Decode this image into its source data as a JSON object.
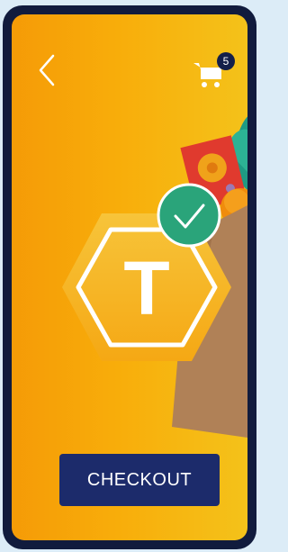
{
  "header": {
    "back_icon": "chevron-left-icon",
    "cart_icon": "shopping-cart-icon",
    "cart_count": "5"
  },
  "badge": {
    "letter": "T",
    "check_icon": "checkmark-icon"
  },
  "actions": {
    "checkout_label": "CHECKOUT"
  },
  "colors": {
    "frame": "#111b3d",
    "gradient_start": "#f59b07",
    "gradient_end": "#f4c21a",
    "button": "#1c2b6b",
    "check_green": "#2aa47a",
    "bag": "#b08157"
  }
}
